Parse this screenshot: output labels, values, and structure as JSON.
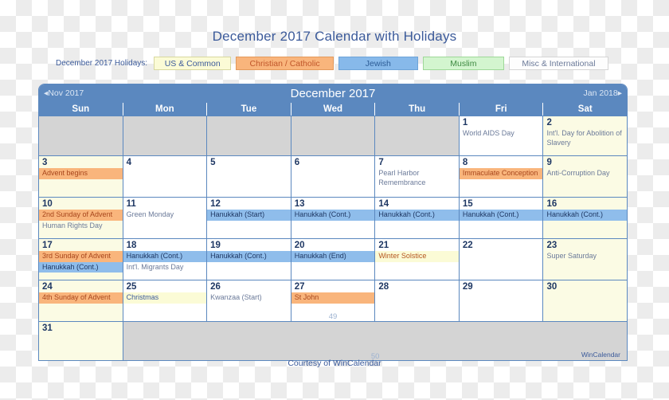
{
  "title": "December 2017 Calendar with Holidays",
  "legend": {
    "label": "December 2017 Holidays:",
    "items": [
      {
        "key": "us",
        "text": "US & Common"
      },
      {
        "key": "chr",
        "text": "Christian / Catholic"
      },
      {
        "key": "jew",
        "text": "Jewish"
      },
      {
        "key": "mus",
        "text": "Muslim"
      },
      {
        "key": "misc",
        "text": "Misc & International"
      }
    ]
  },
  "calendar": {
    "month_title": "December 2017",
    "prev_label": "◂Nov 2017",
    "next_label": "Jan 2018▸",
    "weekdays": [
      "Sun",
      "Mon",
      "Tue",
      "Wed",
      "Thu",
      "Fri",
      "Sat"
    ],
    "week_numbers": {
      "week5": "49",
      "week6": "50"
    },
    "brand": "WinCalendar",
    "weeks": [
      {
        "days": [
          {
            "num": "",
            "blank": true,
            "events": []
          },
          {
            "num": "",
            "blank": true,
            "events": []
          },
          {
            "num": "",
            "blank": true,
            "events": []
          },
          {
            "num": "",
            "blank": true,
            "events": []
          },
          {
            "num": "",
            "blank": true,
            "events": []
          },
          {
            "num": "1",
            "events": [
              {
                "text": "World AIDS Day",
                "cat": "misc"
              }
            ]
          },
          {
            "num": "2",
            "weekend": true,
            "events": [
              {
                "text": "Int'l. Day for Abolition of Slavery",
                "cat": "misc"
              }
            ]
          }
        ]
      },
      {
        "days": [
          {
            "num": "3",
            "weekend": true,
            "events": [
              {
                "text": "Advent begins",
                "cat": "chr"
              }
            ]
          },
          {
            "num": "4",
            "events": []
          },
          {
            "num": "5",
            "events": []
          },
          {
            "num": "6",
            "events": []
          },
          {
            "num": "7",
            "events": [
              {
                "text": "Pearl Harbor Remembrance",
                "cat": "misc"
              }
            ]
          },
          {
            "num": "8",
            "events": [
              {
                "text": "Immaculate Conception",
                "cat": "chr"
              }
            ]
          },
          {
            "num": "9",
            "weekend": true,
            "events": [
              {
                "text": "Anti-Corruption Day",
                "cat": "misc"
              }
            ]
          }
        ]
      },
      {
        "days": [
          {
            "num": "10",
            "weekend": true,
            "events": [
              {
                "text": "2nd Sunday of Advent",
                "cat": "chr"
              },
              {
                "text": "Human Rights Day",
                "cat": "misc"
              }
            ]
          },
          {
            "num": "11",
            "events": [
              {
                "text": "Green Monday",
                "cat": "misc"
              }
            ]
          },
          {
            "num": "12",
            "events": [
              {
                "text": "Hanukkah (Start)",
                "cat": "jew"
              }
            ]
          },
          {
            "num": "13",
            "events": [
              {
                "text": "Hanukkah (Cont.)",
                "cat": "jew"
              }
            ]
          },
          {
            "num": "14",
            "events": [
              {
                "text": "Hanukkah (Cont.)",
                "cat": "jew"
              }
            ]
          },
          {
            "num": "15",
            "events": [
              {
                "text": "Hanukkah (Cont.)",
                "cat": "jew"
              }
            ]
          },
          {
            "num": "16",
            "weekend": true,
            "events": [
              {
                "text": "Hanukkah (Cont.)",
                "cat": "jew"
              }
            ]
          }
        ]
      },
      {
        "days": [
          {
            "num": "17",
            "weekend": true,
            "events": [
              {
                "text": "3rd Sunday of Advent",
                "cat": "chr"
              },
              {
                "text": "Hanukkah (Cont.)",
                "cat": "jew"
              }
            ]
          },
          {
            "num": "18",
            "events": [
              {
                "text": "Hanukkah (Cont.)",
                "cat": "jew"
              },
              {
                "text": "Int'l. Migrants Day",
                "cat": "misc"
              }
            ]
          },
          {
            "num": "19",
            "events": [
              {
                "text": "Hanukkah (Cont.)",
                "cat": "jew"
              }
            ]
          },
          {
            "num": "20",
            "events": [
              {
                "text": "Hanukkah (End)",
                "cat": "jew"
              }
            ]
          },
          {
            "num": "21",
            "events": [
              {
                "text": "Winter Solstice",
                "cat": "us"
              }
            ]
          },
          {
            "num": "22",
            "events": []
          },
          {
            "num": "23",
            "weekend": true,
            "events": [
              {
                "text": "Super Saturday",
                "cat": "misc"
              }
            ]
          }
        ]
      },
      {
        "days": [
          {
            "num": "24",
            "weekend": true,
            "events": [
              {
                "text": "4th Sunday of Advent",
                "cat": "chr"
              }
            ]
          },
          {
            "num": "25",
            "events": [
              {
                "text": "Christmas",
                "cat": "usblue"
              }
            ]
          },
          {
            "num": "26",
            "events": [
              {
                "text": "Kwanzaa (Start)",
                "cat": "misc"
              }
            ]
          },
          {
            "num": "27",
            "events": [
              {
                "text": "St John",
                "cat": "chr"
              }
            ]
          },
          {
            "num": "28",
            "events": []
          },
          {
            "num": "29",
            "events": []
          },
          {
            "num": "30",
            "weekend": true,
            "events": []
          }
        ]
      },
      {
        "days": [
          {
            "num": "31",
            "weekend": true,
            "events": []
          }
        ]
      }
    ]
  },
  "footer": "Courtesy of WinCalendar"
}
